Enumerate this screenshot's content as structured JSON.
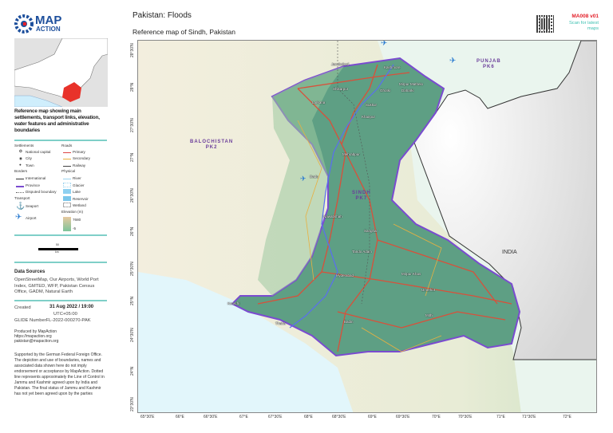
{
  "logo": {
    "line1": "MAP",
    "line2": "ACTION"
  },
  "header": {
    "title": "Pakistan: Floods",
    "subtitle": "Reference map of Sindh, Pakistan",
    "map_code": "MA008 v01",
    "scan_text": "Scan for latest maps"
  },
  "description": "Reference map showing main settlements, transport links, elevation, water features and administrative boundaries",
  "legend": {
    "settlements_title": "Settlements",
    "settlements": [
      "National capital",
      "City",
      "Town"
    ],
    "roads_title": "Roads",
    "roads": [
      "Primary",
      "Secondary",
      "Railway"
    ],
    "borders_title": "Borders",
    "borders": [
      "International",
      "Province",
      "Disputed boundary"
    ],
    "physical_title": "Physical",
    "physical": [
      "River",
      "Glacier",
      "Lake",
      "Reservoir",
      "Wetland"
    ],
    "transport_title": "Transport",
    "transport": [
      "Seaport",
      "Airport"
    ],
    "elevation_title": "Elevation (m)",
    "elevation_max": "7680",
    "elevation_min": "-5",
    "scale_top": "50",
    "scale_bottom": "km"
  },
  "sources": {
    "title": "Data Sources",
    "text": "OpenStreetMap, Our Airports, World Port Index, GMTED, WFP, Pakistan Census Office, GADM, Natural Earth"
  },
  "meta": {
    "created_label": "Created",
    "created_value": "31 Aug 2022 / 19:00",
    "timezone": "UTC+05:00",
    "glide": "GLIDE NumberFL-2022-000270-PAK",
    "produced": "Produced by MapAction",
    "url": "https://mapaction.org",
    "email": "pakistan@mapaction.org",
    "disclaimer": "Supported by the German Federal Foreign Office. The depiction and use of boundaries, names and associated data shown here do not imply endorsement or acceptance by MapAction. Dotted line represents approximately the Line of Control in Jammu and Kashmir agreed upon by India and Pakistan. The final status of Jammu and Kashmir has not yet been agreed upon by the parties"
  },
  "map": {
    "regions": {
      "balochistan": "BALOCHISTAN",
      "balochistan_code": "PK2",
      "punjab": "PUNJAB",
      "punjab_code": "PK6",
      "sindh": "SINDH",
      "sindh_code": "PK7",
      "india": "INDIA"
    },
    "cities": [
      "Jacobabad",
      "Kashmore",
      "Shikarpur",
      "Ghotki",
      "Mirpur Mathelo",
      "Daharki",
      "Sukkur",
      "Larkana",
      "Khairpur",
      "Dadu",
      "Mehrabpur",
      "Nawabshah",
      "Sanghar",
      "Tando Adam",
      "Hyderabad",
      "Mirpur Khas",
      "Umerkot",
      "Karachi",
      "Thatta",
      "Badin",
      "Mithi"
    ],
    "lon_ticks": [
      "65°30'E",
      "66°E",
      "66°30'E",
      "67°E",
      "67°30'E",
      "68°E",
      "68°30'E",
      "69°E",
      "69°30'E",
      "70°E",
      "70°30'E",
      "71°E",
      "71°30'E",
      "72°E"
    ],
    "lat_ticks": [
      "28°30'N",
      "28°N",
      "27°30'N",
      "27°N",
      "26°30'N",
      "26°N",
      "25°30'N",
      "25°N",
      "24°30'N",
      "24°N",
      "23°30'N"
    ]
  },
  "colors": {
    "brand": "#1d4f9c",
    "accent": "#3bbfb0",
    "code_red": "#e3202a",
    "sindh_fill": "#5e9f84",
    "highlight": "#e8322a"
  }
}
